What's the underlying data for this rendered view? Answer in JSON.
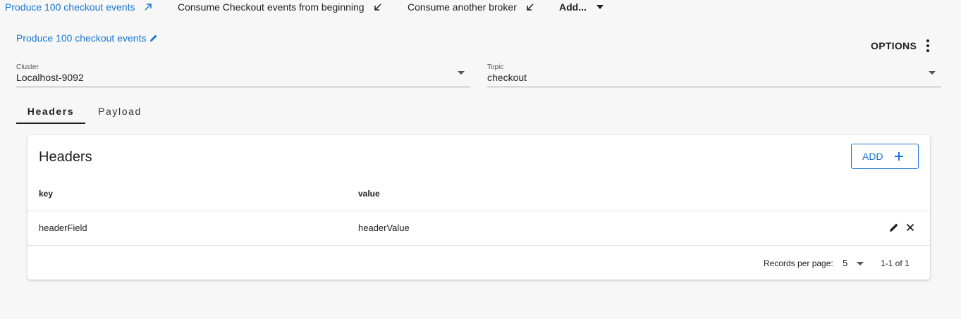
{
  "top_tabs": [
    {
      "label": "Produce 100 checkout events",
      "arrow_icon": "arrow-up-right-icon"
    },
    {
      "label": "Consume Checkout events from beginning",
      "arrow_icon": "arrow-down-left-icon"
    },
    {
      "label": "Consume another broker",
      "arrow_icon": "arrow-down-left-icon"
    },
    {
      "label": "Add...",
      "arrow_icon": "caret-down-icon"
    }
  ],
  "request": {
    "title": "Produce 100 checkout events",
    "options_label": "OPTIONS"
  },
  "cluster": {
    "label": "Cluster",
    "value": "Localhost-9092"
  },
  "topic": {
    "label": "Topic",
    "value": "checkout"
  },
  "tabs": [
    {
      "label": "Headers"
    },
    {
      "label": "Payload"
    }
  ],
  "headers_card": {
    "title": "Headers",
    "add_label": "ADD",
    "columns": [
      "key",
      "value"
    ],
    "rows": [
      {
        "key": "headerField",
        "value": "headerValue"
      }
    ],
    "pagination": {
      "records_label": "Records per page:",
      "per_page": "5",
      "range": "1-1 of 1"
    }
  },
  "colors": {
    "accent": "#1976d2",
    "background": "#f7f7f7"
  }
}
